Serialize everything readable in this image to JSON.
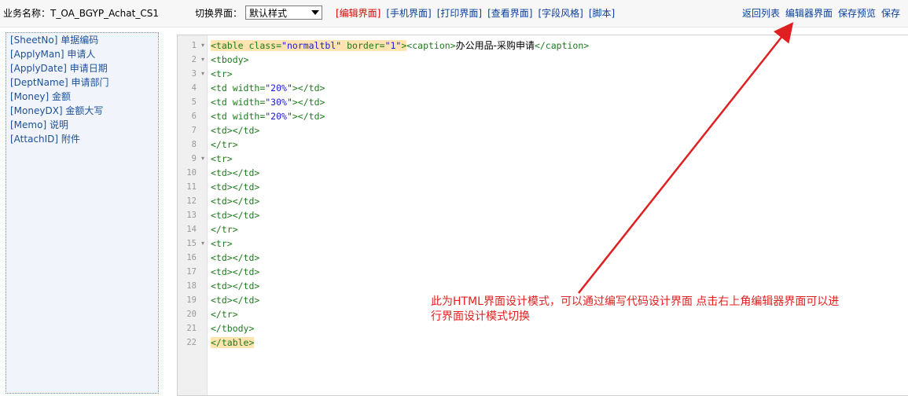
{
  "topbar": {
    "biz_label": "业务名称：T_OA_BGYP_Achat_CS1",
    "switch_label": "切换界面：",
    "select_value": "默认样式",
    "views": [
      "[编辑界面]",
      "[手机界面]",
      "[打印界面]",
      "[查看界面]",
      "[字段风格]",
      "[脚本]"
    ],
    "actions": [
      "返回列表",
      "编辑器界面",
      "保存预览",
      "保存"
    ]
  },
  "fields": [
    "[SheetNo] 单据编码",
    "[ApplyMan] 申请人",
    "[ApplyDate] 申请日期",
    "[DeptName] 申请部门",
    "[Money] 金额",
    "[MoneyDX] 金额大写",
    "[Memo] 说明",
    "[AttachID] 附件"
  ],
  "code": {
    "line_numbers": [
      "1",
      "2",
      "3",
      "4",
      "5",
      "6",
      "7",
      "8",
      "9",
      "10",
      "11",
      "12",
      "13",
      "14",
      "15",
      "16",
      "17",
      "18",
      "19",
      "20",
      "21",
      "22"
    ],
    "fold_lines": [
      1,
      2,
      3,
      9,
      15
    ],
    "line1": {
      "tag_open": "<table",
      "attr1": " class=",
      "val1": "\"normaltbl\"",
      "attr2": " border=",
      "val2": "\"1\"",
      "tag_close": ">",
      "caption_open": "<caption>",
      "caption_text": "办公用品-采购申请",
      "caption_close": "</caption>"
    },
    "line2": "<tbody>",
    "line3": "<tr>",
    "td_width_lines": [
      {
        "prefix": "<td",
        "attr": " width=",
        "val": "\"20%\"",
        "suffix": "></td>"
      },
      {
        "prefix": "<td",
        "attr": " width=",
        "val": "\"30%\"",
        "suffix": "></td>"
      },
      {
        "prefix": "<td",
        "attr": " width=",
        "val": "\"20%\"",
        "suffix": "></td>"
      }
    ],
    "rest_lines": [
      "<td></td>",
      "</tr>",
      "<tr>",
      "<td></td>",
      "<td></td>",
      "<td></td>",
      "<td></td>",
      "</tr>",
      "<tr>",
      "<td></td>",
      "<td></td>",
      "<td></td>",
      "<td></td>",
      "</tr>",
      "</tbody>"
    ],
    "line22": "</table>"
  },
  "annotation": {
    "line1": "此为HTML界面设计模式，可以通过编写代码设计界面   点击右上角编辑器界面可以进",
    "line2": "行界面设计模式切换",
    "color": "#e02020"
  }
}
